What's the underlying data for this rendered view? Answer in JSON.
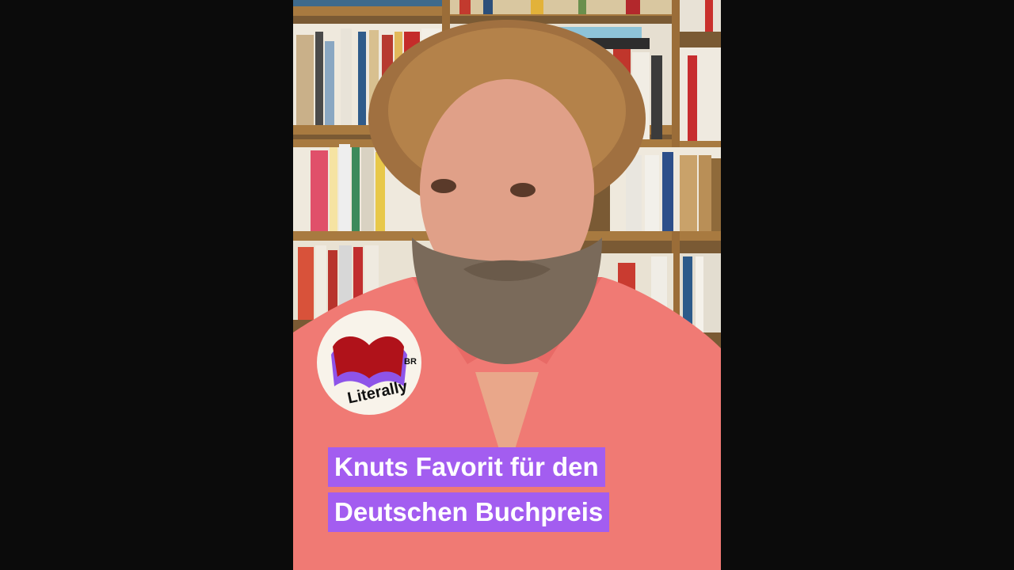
{
  "video": {
    "logo": {
      "brand_text": "Literally",
      "network_text": "BR"
    },
    "caption": {
      "line1": "Knuts Favorit für den",
      "line2": "Deutschen Buchpreis"
    },
    "colors": {
      "caption_bg": "#a35df0",
      "shirt": "#f07a74",
      "page_bg": "#0b0b0b",
      "logo_book_red": "#b0121a",
      "logo_purple": "#8e54e9"
    }
  }
}
